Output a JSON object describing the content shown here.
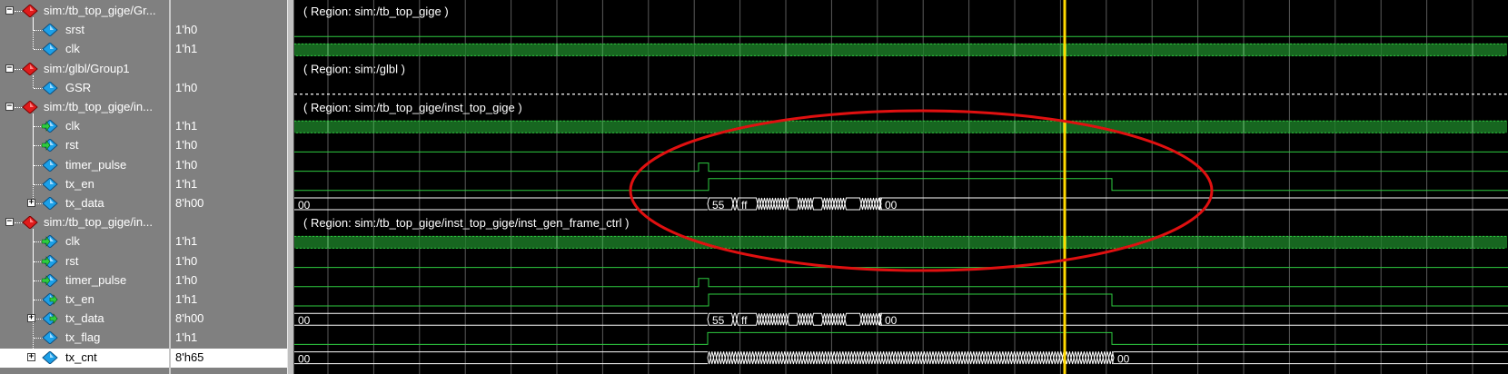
{
  "colors": {
    "wave_bg": "#000000",
    "wave_green": "#2ecc40",
    "grid": "#5a5a5a",
    "cursor": "#ffd800",
    "ellipse": "#e01010",
    "group_icon": "#e01b1b",
    "signal_icon": "#1ca0e8",
    "region_text": "#ffffff"
  },
  "rows": [
    {
      "name": "sim:/tb_top_gige/Gr...",
      "value": "",
      "kind": "group",
      "icon": "red-diamond-icon",
      "expanded": true,
      "region": "( Region: sim:/tb_top_gige )"
    },
    {
      "name": "srst",
      "value": "1'h0",
      "kind": "signal",
      "icon": "signal-diamond-icon",
      "wave": "low"
    },
    {
      "name": "clk",
      "value": "1'h1",
      "kind": "signal",
      "icon": "signal-diamond-icon",
      "wave": "clock"
    },
    {
      "name": "sim:/glbl/Group1",
      "value": "",
      "kind": "group",
      "icon": "red-diamond-icon",
      "expanded": true,
      "region": "( Region: sim:/glbl )"
    },
    {
      "name": "GSR",
      "value": "1'h0",
      "kind": "signal",
      "icon": "signal-diamond-icon",
      "wave": "dashed"
    },
    {
      "name": "sim:/tb_top_gige/in...",
      "value": "",
      "kind": "group",
      "icon": "red-diamond-icon",
      "expanded": true,
      "region": "( Region: sim:/tb_top_gige/inst_top_gige )"
    },
    {
      "name": "clk",
      "value": "1'h1",
      "kind": "signal",
      "icon": "input-arrow-icon",
      "wave": "clock"
    },
    {
      "name": "rst",
      "value": "1'h0",
      "kind": "signal",
      "icon": "input-arrow-icon",
      "wave": "low"
    },
    {
      "name": "timer_pulse",
      "value": "1'h0",
      "kind": "signal",
      "icon": "signal-diamond-icon",
      "wave": "pulse"
    },
    {
      "name": "tx_en",
      "value": "1'h1",
      "kind": "signal",
      "icon": "signal-diamond-icon",
      "wave": "en"
    },
    {
      "name": "tx_data",
      "value": "8'h00",
      "kind": "bus",
      "icon": "signal-diamond-icon",
      "wave": "data",
      "bus_text": {
        "start": "00",
        "v1": "55",
        "v2": "ff",
        "end": "00"
      }
    },
    {
      "name": "sim:/tb_top_gige/in...",
      "value": "",
      "kind": "group",
      "icon": "red-diamond-icon",
      "expanded": true,
      "region": "( Region: sim:/tb_top_gige/inst_top_gige/inst_gen_frame_ctrl )"
    },
    {
      "name": "clk",
      "value": "1'h1",
      "kind": "signal",
      "icon": "input-arrow-icon",
      "wave": "clock"
    },
    {
      "name": "rst",
      "value": "1'h0",
      "kind": "signal",
      "icon": "input-arrow-icon",
      "wave": "low"
    },
    {
      "name": "timer_pulse",
      "value": "1'h0",
      "kind": "signal",
      "icon": "input-arrow-icon",
      "wave": "pulse"
    },
    {
      "name": "tx_en",
      "value": "1'h1",
      "kind": "signal",
      "icon": "output-arrow-icon",
      "wave": "en"
    },
    {
      "name": "tx_data",
      "value": "8'h00",
      "kind": "bus",
      "icon": "output-arrow-icon",
      "wave": "data",
      "bus_text": {
        "start": "00",
        "v1": "55",
        "v2": "ff",
        "end": "00"
      }
    },
    {
      "name": "tx_flag",
      "value": "1'h1",
      "kind": "signal",
      "icon": "signal-diamond-icon",
      "wave": "flag"
    },
    {
      "name": "tx_cnt",
      "value": "8'h65",
      "kind": "bus",
      "icon": "signal-diamond-icon",
      "wave": "cnt",
      "selected": true,
      "bus_text": {
        "start": "00",
        "end": "00"
      }
    }
  ]
}
